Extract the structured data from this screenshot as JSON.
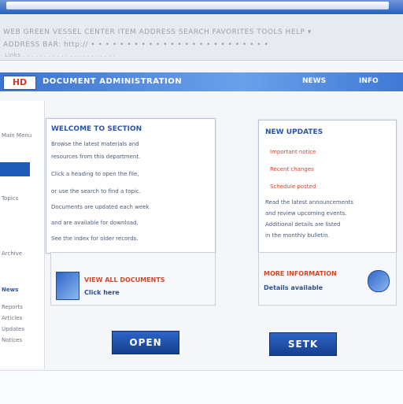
{
  "window": {
    "title_bar": ""
  },
  "menubar": {
    "row1": "WEB GREEN VESSEL  CENTER  ITEM  ADDRESS  SEARCH  FAVORITES  TOOLS  HELP  ▾",
    "row2": "ADDRESS BAR: http://  • • • • • • • • • • • • • • • • • • • • • • • • •",
    "row3": "Links  .  .  .  .  .  .  .  .  .  .  .  .  .  .  .  .  .  .  .  .  .  ."
  },
  "header": {
    "logo_text": "HD",
    "title": "DOCUMENT ADMINISTRATION",
    "nav": [
      "NEWS",
      "INFO"
    ]
  },
  "sidebar": {
    "items": [
      "Main Menu",
      "Topics",
      "Archive",
      "News",
      "Reports",
      "Articles",
      "Updates",
      "Notices"
    ]
  },
  "left_panel": {
    "heading": "WELCOME TO SECTION",
    "lines": [
      "Browse the latest materials and",
      "resources from this department.",
      "Click a heading to open the file,",
      "or use the search to find a topic.",
      "Documents are updated each week",
      "and are available for download.",
      "See the index for older records."
    ],
    "footer_line1": "VIEW ALL DOCUMENTS",
    "footer_line2": "Click here"
  },
  "right_panel": {
    "heading": "NEW UPDATES",
    "red_lines": [
      "Important notice",
      "Recent changes",
      "Schedule posted"
    ],
    "lines": [
      "Read the latest announcements",
      "and review upcoming events.",
      "Additional details are listed",
      "in the monthly bulletin."
    ],
    "footer_line1": "MORE INFORMATION",
    "footer_line2": "Details available"
  },
  "buttons": {
    "left": "OPEN",
    "right": "SETK"
  }
}
